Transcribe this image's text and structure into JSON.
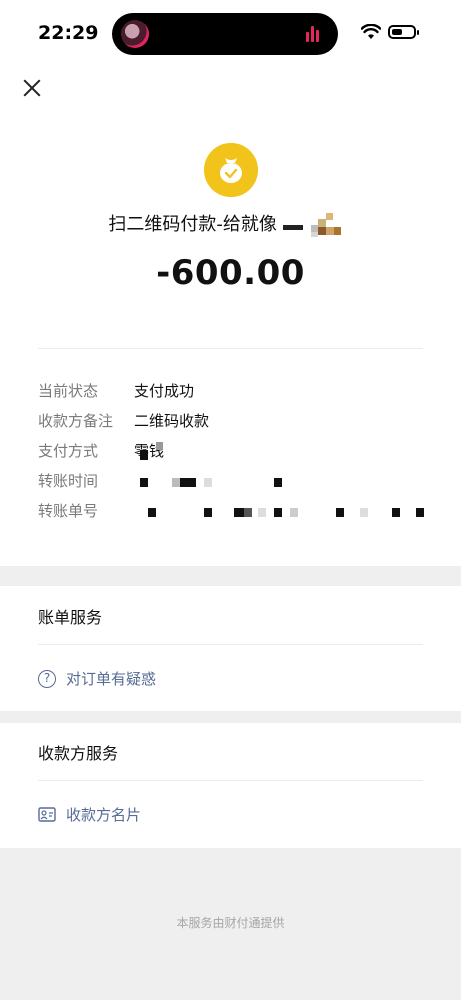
{
  "status_bar": {
    "time": "22:29"
  },
  "header": {
    "close_icon": "close-icon",
    "payment_icon": "money-bag-icon",
    "title": "扫二维码付款-给就像",
    "amount": "-600.00"
  },
  "details": {
    "rows": [
      {
        "label": "当前状态",
        "value": "支付成功"
      },
      {
        "label": "收款方备注",
        "value": "二维码收款"
      },
      {
        "label": "支付方式",
        "value": "零钱"
      },
      {
        "label": "转账时间",
        "value": ""
      },
      {
        "label": "转账单号",
        "value": ""
      }
    ]
  },
  "bill_service": {
    "title": "账单服务",
    "link": "对订单有疑惑",
    "link_icon": "question-circle-icon"
  },
  "payee_service": {
    "title": "收款方服务",
    "link": "收款方名片",
    "link_icon": "business-card-icon"
  },
  "footer": {
    "text": "本服务由财付通提供"
  },
  "colors": {
    "accent_yellow": "#f2c31a",
    "link_blue": "#576b95",
    "gray_bg": "#efefef"
  }
}
